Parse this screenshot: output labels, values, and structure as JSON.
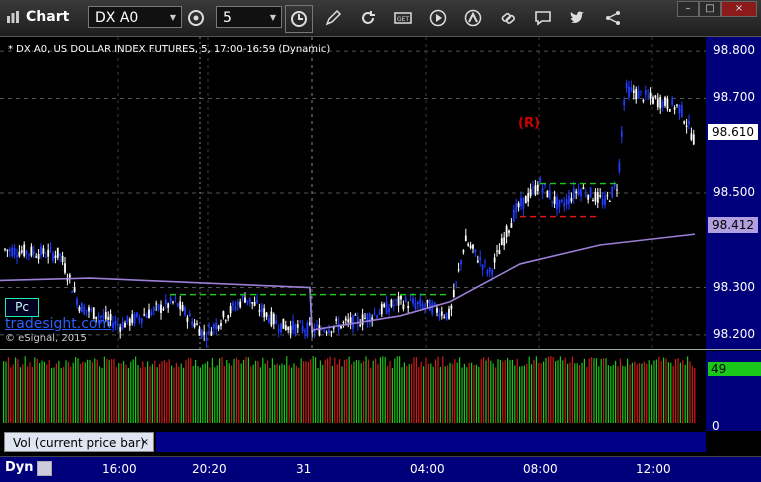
{
  "window": {
    "title": "Chart",
    "minimize": "–",
    "maximize": "□",
    "close": "×"
  },
  "toolbar": {
    "symbol": "DX A0",
    "interval": "5",
    "icons": [
      "cycle-icon",
      "clock-icon",
      "pencil-icon",
      "refresh-icon",
      "get-icon",
      "play-icon",
      "alert-icon",
      "link-icon",
      "chat-icon",
      "twitter-icon",
      "share-icon"
    ]
  },
  "chart": {
    "caption": "* DX A0, US DOLLAR INDEX FUTURES, 5, 17:00-16:59 (Dynamic)",
    "watermark": "tradesight.com",
    "copyright": "© eSignal, 2015",
    "pc_label": "Pc",
    "r_label": "(R)",
    "current_price": "98.610",
    "ma_price": "98.412"
  },
  "chart_data": {
    "type": "candlestick",
    "y_ticks": [
      "98.800",
      "98.700",
      "98.500",
      "98.300",
      "98.200"
    ],
    "y_range": [
      98.17,
      98.83
    ],
    "x_ticks": [
      "16:00",
      "20:20",
      "31",
      "04:00",
      "08:00",
      "12:00"
    ],
    "colors": {
      "up": "#ffffff",
      "down": "#1f3cff",
      "ma": "#9b7fd6",
      "vol_up": "#19c819",
      "vol_down": "#d21919",
      "green_level": "#19c819",
      "red_level": "#e01616"
    }
  },
  "volume": {
    "legend": "Vol (current price bar)",
    "legend_close": "×",
    "value": "49",
    "zero": "0"
  },
  "bottom": {
    "mode": "Dyn"
  }
}
